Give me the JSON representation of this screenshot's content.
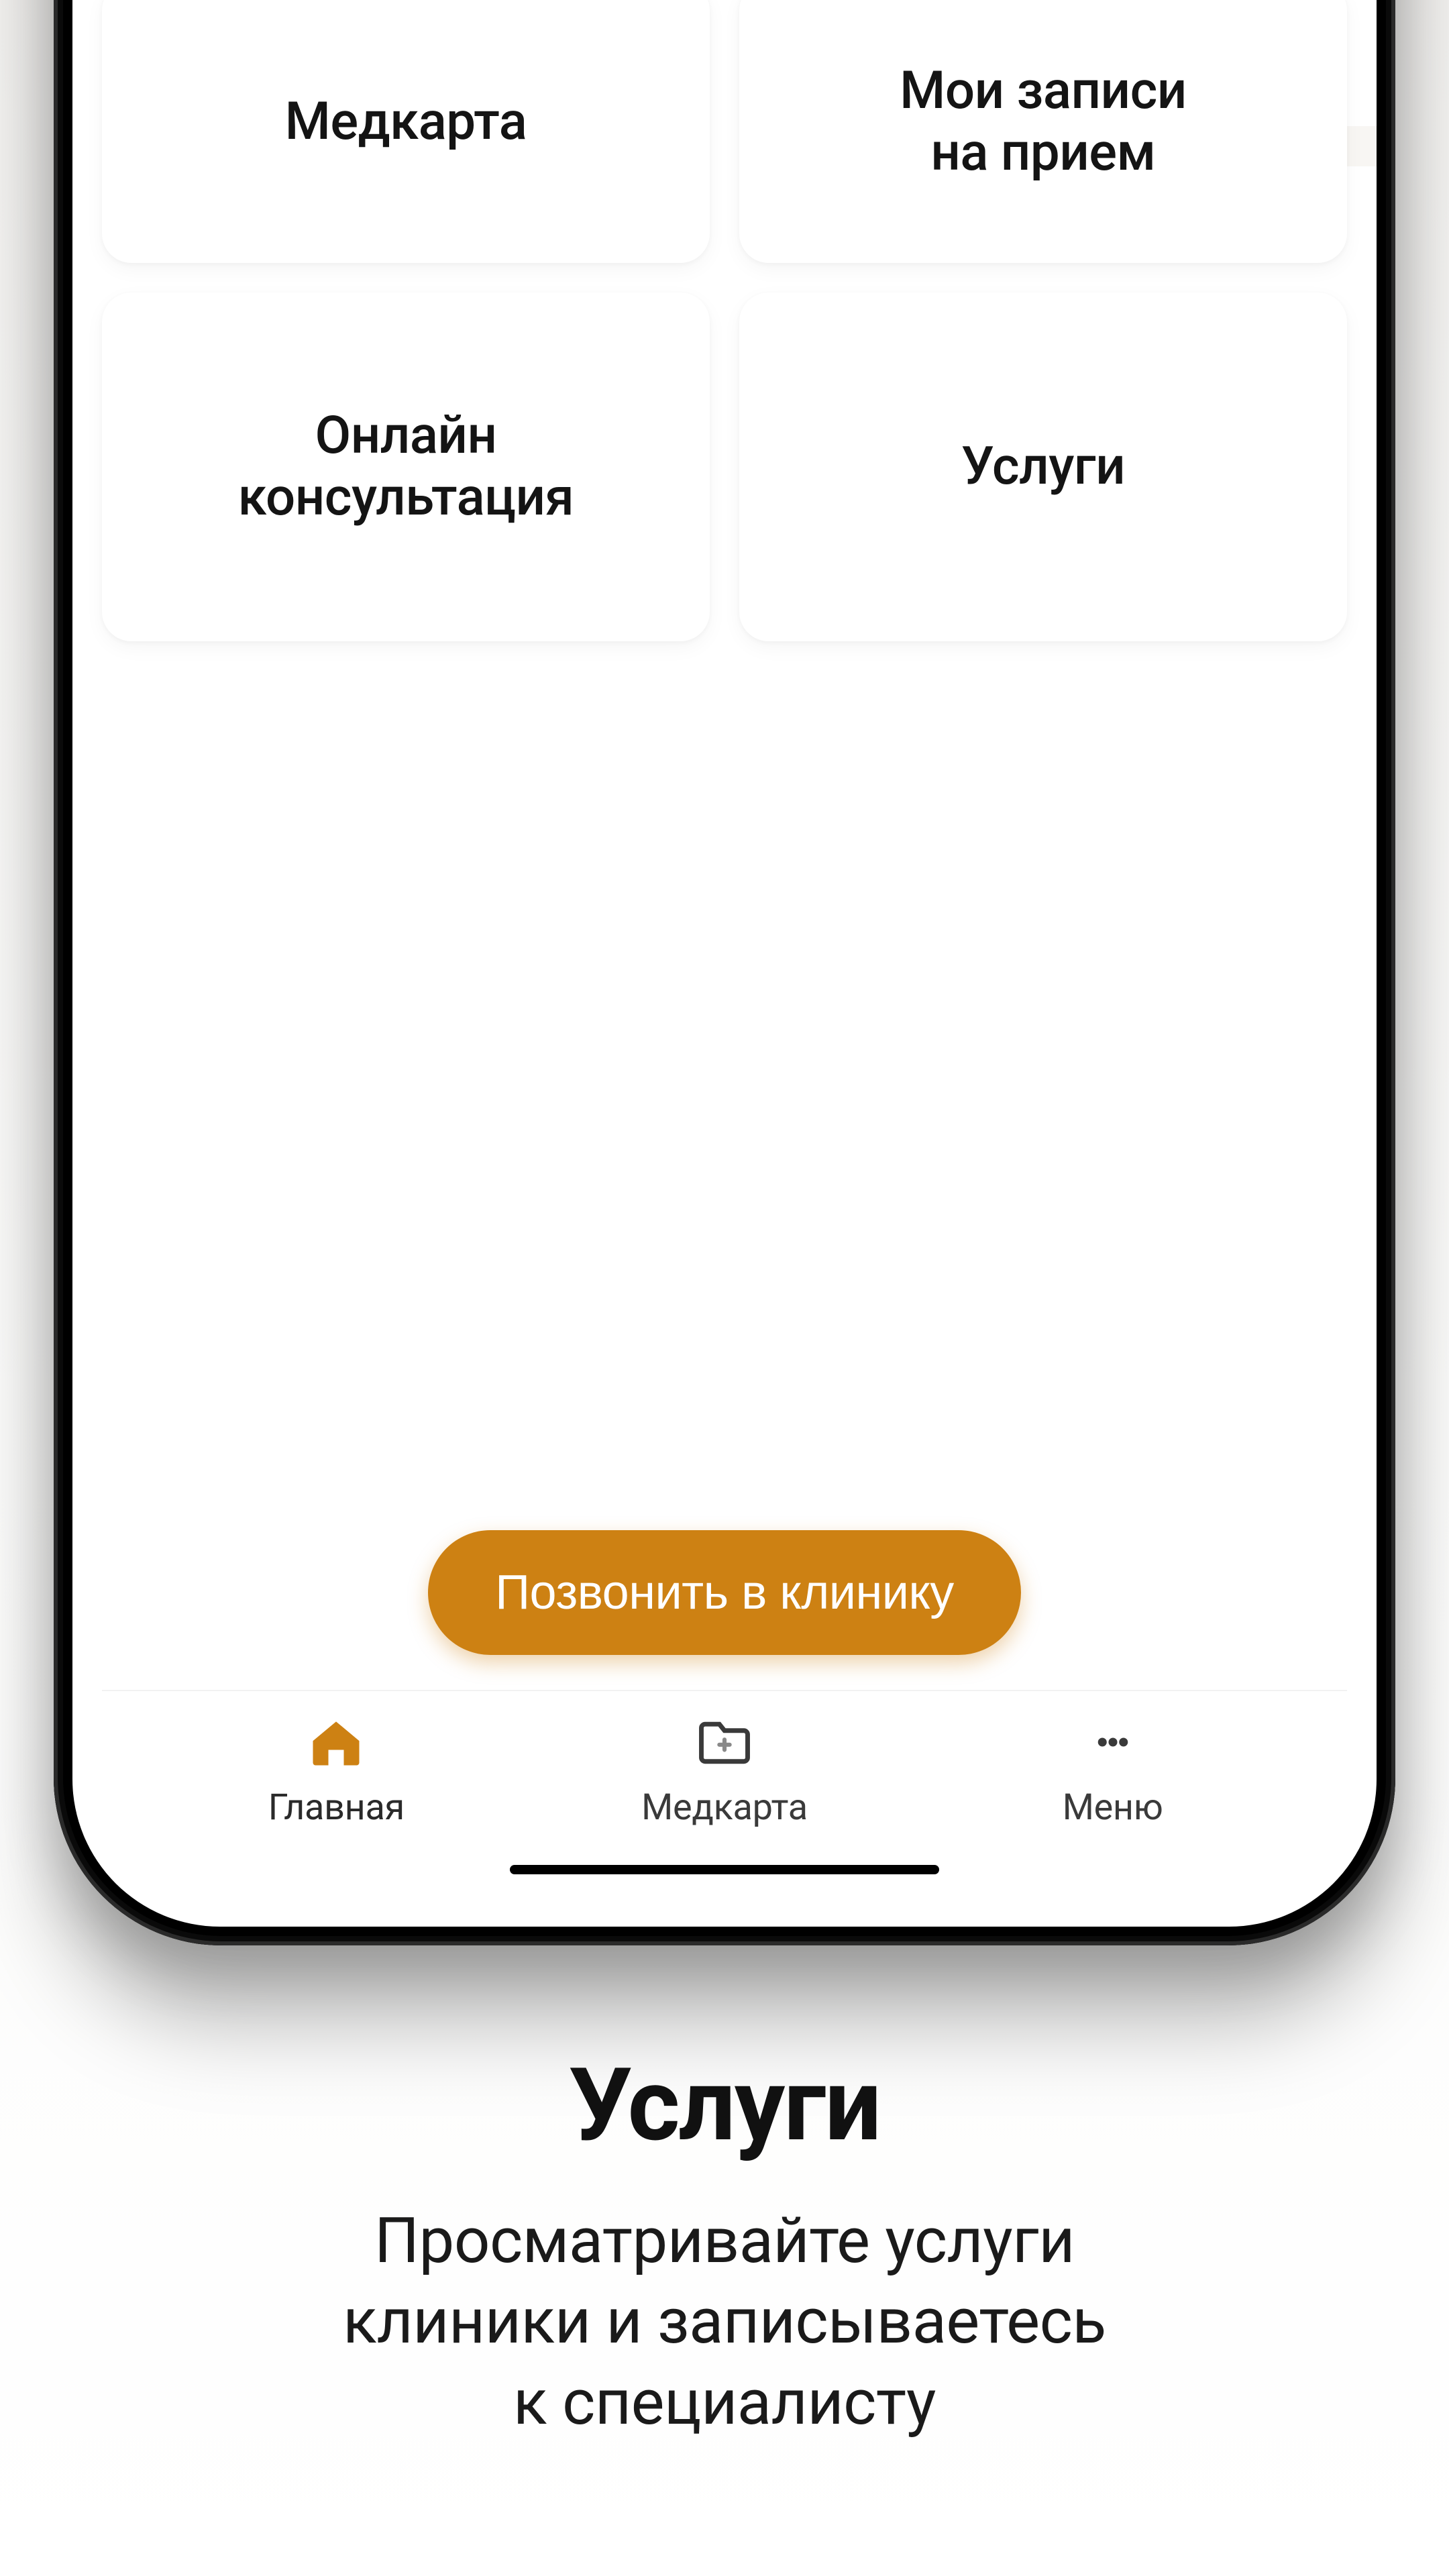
{
  "colors": {
    "accent": "#cd8113"
  },
  "tiles": [
    {
      "label": "Медкарта"
    },
    {
      "label": "Мои записи\nна прием"
    },
    {
      "label": "Онлайн\nконсультация"
    },
    {
      "label": "Услуги"
    }
  ],
  "call_button": {
    "label": "Позвонить в клинику"
  },
  "tabs": {
    "home": {
      "label": "Главная",
      "icon": "home-icon",
      "active": true
    },
    "medcard": {
      "label": "Медкарта",
      "icon": "folder-icon",
      "active": false
    },
    "menu": {
      "label": "Меню",
      "icon": "more-icon",
      "active": false
    }
  },
  "promo": {
    "title": "Услуги",
    "subtitle": "Просматривайте услуги\nклиники и записываетесь\nк специалисту"
  }
}
